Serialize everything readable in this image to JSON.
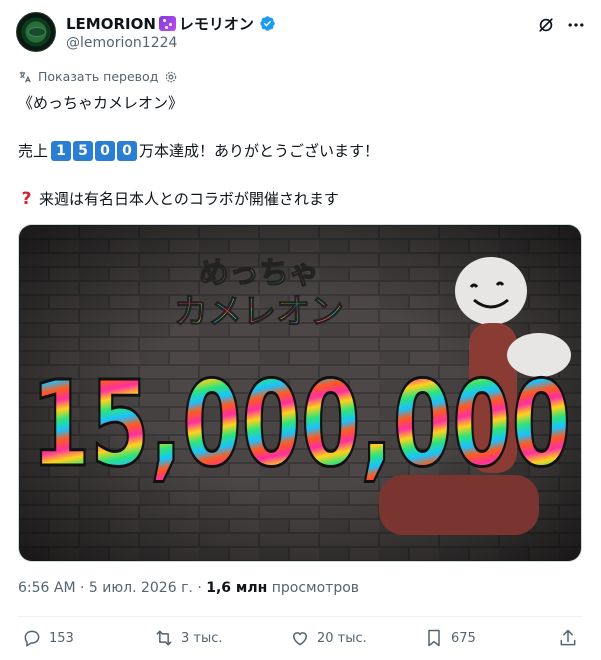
{
  "post": {
    "author": {
      "display_name": "LEMORION",
      "name_suffix": "レモリオン",
      "handle": "@lemorion1224",
      "verified": true
    },
    "translate_label": "Показать перевод",
    "lines": [
      "《めっちゃカメレオン》",
      {
        "prefix": "売上",
        "digits": [
          "1",
          "5",
          "0",
          "0"
        ],
        "suffix": "万本達成！ありがとうございます！"
      },
      {
        "icon": "red-question-mark",
        "text": "来週は有名日本人とのコラボが開催されます"
      }
    ],
    "image": {
      "title_line1": "めっちゃ",
      "title_line2": "カメレオン",
      "big_number": "15,000,000"
    },
    "meta": {
      "time": "6:56 AM",
      "date": "5 июл. 2026 г.",
      "views_count": "1,6 млн",
      "views_label": "просмотров",
      "separator": "·"
    },
    "actions": {
      "replies": "153",
      "reposts": "3 тыс.",
      "likes": "20 тыс.",
      "bookmarks": "675"
    }
  },
  "colors": {
    "text": "#0f1419",
    "secondary": "#536471",
    "link": "#1d9bf0",
    "verified": "#1d9bf0",
    "keycap": "#2a7fd4"
  }
}
